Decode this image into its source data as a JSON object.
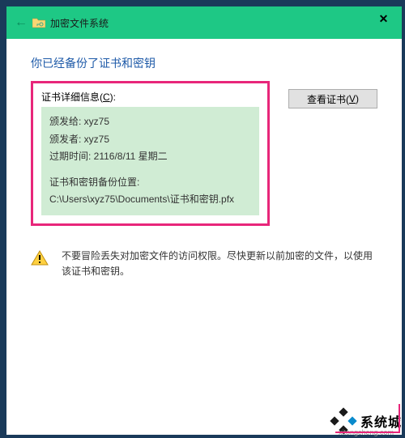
{
  "titlebar": {
    "title": "加密文件系统",
    "back_icon": "arrow-left",
    "folder_icon": "folder-key",
    "close_label": "✕"
  },
  "heading": "你已经备份了证书和密钥",
  "cert_details": {
    "label_prefix": "证书详细信息(",
    "label_key": "C",
    "label_suffix": "):",
    "issued_to_label": "颁发给: ",
    "issued_to_value": "xyz75",
    "issued_by_label": "颁发者: ",
    "issued_by_value": "xyz75",
    "expiry_label": "过期时间: ",
    "expiry_value": "2116/8/11 星期二",
    "backup_location_label": "证书和密钥备份位置:",
    "backup_location_value": "C:\\Users\\xyz75\\Documents\\证书和密钥.pfx"
  },
  "view_cert_button": {
    "label_prefix": "查看证书(",
    "label_key": "V",
    "label_suffix": ")"
  },
  "warning": {
    "text": "不要冒险丢失对加密文件的访问权限。尽快更新以前加密的文件，以使用该证书和密钥。"
  },
  "watermark": {
    "text": "系统城",
    "sub": "xitongcheng.com"
  }
}
